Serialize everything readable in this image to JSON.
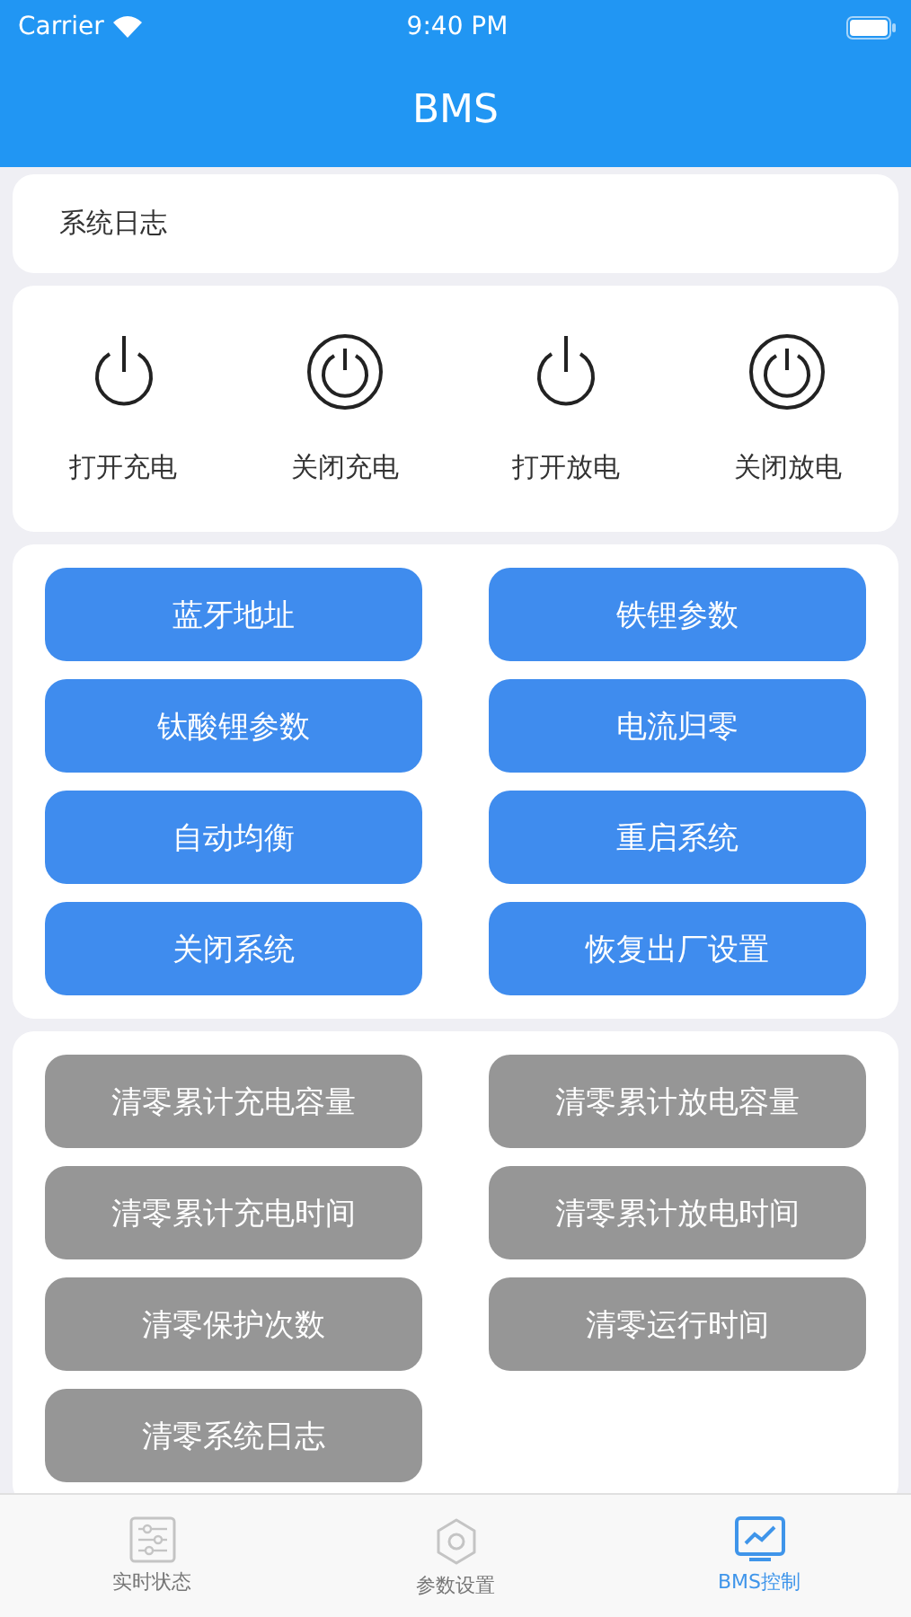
{
  "status_bar": {
    "carrier": "Carrier",
    "time": "9:40 PM"
  },
  "header": {
    "title": "BMS"
  },
  "log": {
    "label": "系统日志"
  },
  "power_controls": [
    {
      "label": "打开充电",
      "kind": "plain"
    },
    {
      "label": "关闭充电",
      "kind": "ring"
    },
    {
      "label": "打开放电",
      "kind": "plain"
    },
    {
      "label": "关闭放电",
      "kind": "ring"
    }
  ],
  "command_groups": [
    {
      "buttons": [
        {
          "label": "蓝牙地址",
          "disabled": false
        },
        {
          "label": "铁锂参数",
          "disabled": false
        },
        {
          "label": "钛酸锂参数",
          "disabled": false
        },
        {
          "label": "电流归零",
          "disabled": false
        },
        {
          "label": "自动均衡",
          "disabled": false
        },
        {
          "label": "重启系统",
          "disabled": false
        },
        {
          "label": "关闭系统",
          "disabled": false
        },
        {
          "label": "恢复出厂设置",
          "disabled": false
        }
      ]
    },
    {
      "buttons": [
        {
          "label": "清零累计充电容量",
          "disabled": true
        },
        {
          "label": "清零累计放电容量",
          "disabled": true
        },
        {
          "label": "清零累计充电时间",
          "disabled": true
        },
        {
          "label": "清零累计放电时间",
          "disabled": true
        },
        {
          "label": "清零保护次数",
          "disabled": true
        },
        {
          "label": "清零运行时间",
          "disabled": true
        },
        {
          "label": "清零系统日志",
          "disabled": true
        }
      ]
    }
  ],
  "tab_bar": [
    {
      "label": "实时状态",
      "kind": "sliders",
      "selected": false
    },
    {
      "label": "参数设置",
      "kind": "gear",
      "selected": false
    },
    {
      "label": "BMS控制",
      "kind": "chart",
      "selected": true
    }
  ]
}
